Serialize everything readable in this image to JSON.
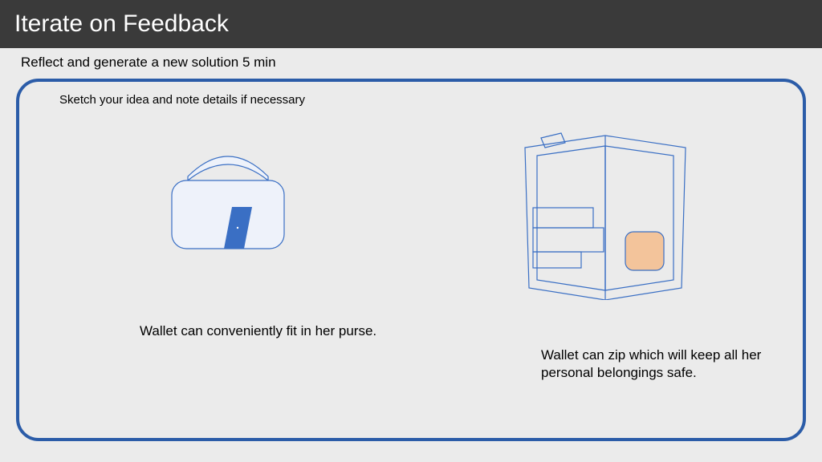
{
  "header": {
    "title": "Iterate on Feedback"
  },
  "subhead": "Reflect and generate a new solution 5 min",
  "card": {
    "label": "Sketch your idea and note details if necessary",
    "leftCaption": "Wallet can conveniently fit in her purse.",
    "rightCaption": "Wallet can zip which will keep all her personal belongings safe."
  }
}
